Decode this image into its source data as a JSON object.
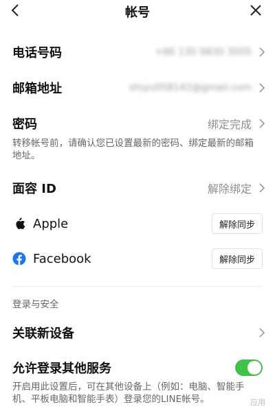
{
  "header": {
    "title": "帐号"
  },
  "rows": {
    "phone": {
      "label": "电话号码",
      "value": "+86 130 9830 3005"
    },
    "email": {
      "label": "邮箱地址",
      "value": "shiyu058142@gmail.com"
    },
    "password": {
      "label": "密码",
      "value": "绑定完成"
    },
    "face_id": {
      "label": "面容 ID",
      "value": "解除绑定"
    }
  },
  "password_note": "转移帐号前，请确认您已设置最新的密码、绑定最新的邮箱地址。",
  "social": {
    "apple": {
      "label": "Apple",
      "button": "解除同步"
    },
    "facebook": {
      "label": "Facebook",
      "button": "解除同步"
    }
  },
  "security": {
    "section_title": "登录与安全",
    "link_device": {
      "label": "关联新设备"
    },
    "allow_login": {
      "label": "允许登录其他服务",
      "enabled": true,
      "note": "开启用此设置后，可在其他设备上（例如：电脑、智能手机、平板电脑和智能手表）登录您的LINE帐号。"
    }
  },
  "watermark": "应用",
  "colors": {
    "toggle_on": "#3ec24a",
    "facebook_blue": "#1877f2",
    "secondary_text": "#8e8e8e"
  }
}
